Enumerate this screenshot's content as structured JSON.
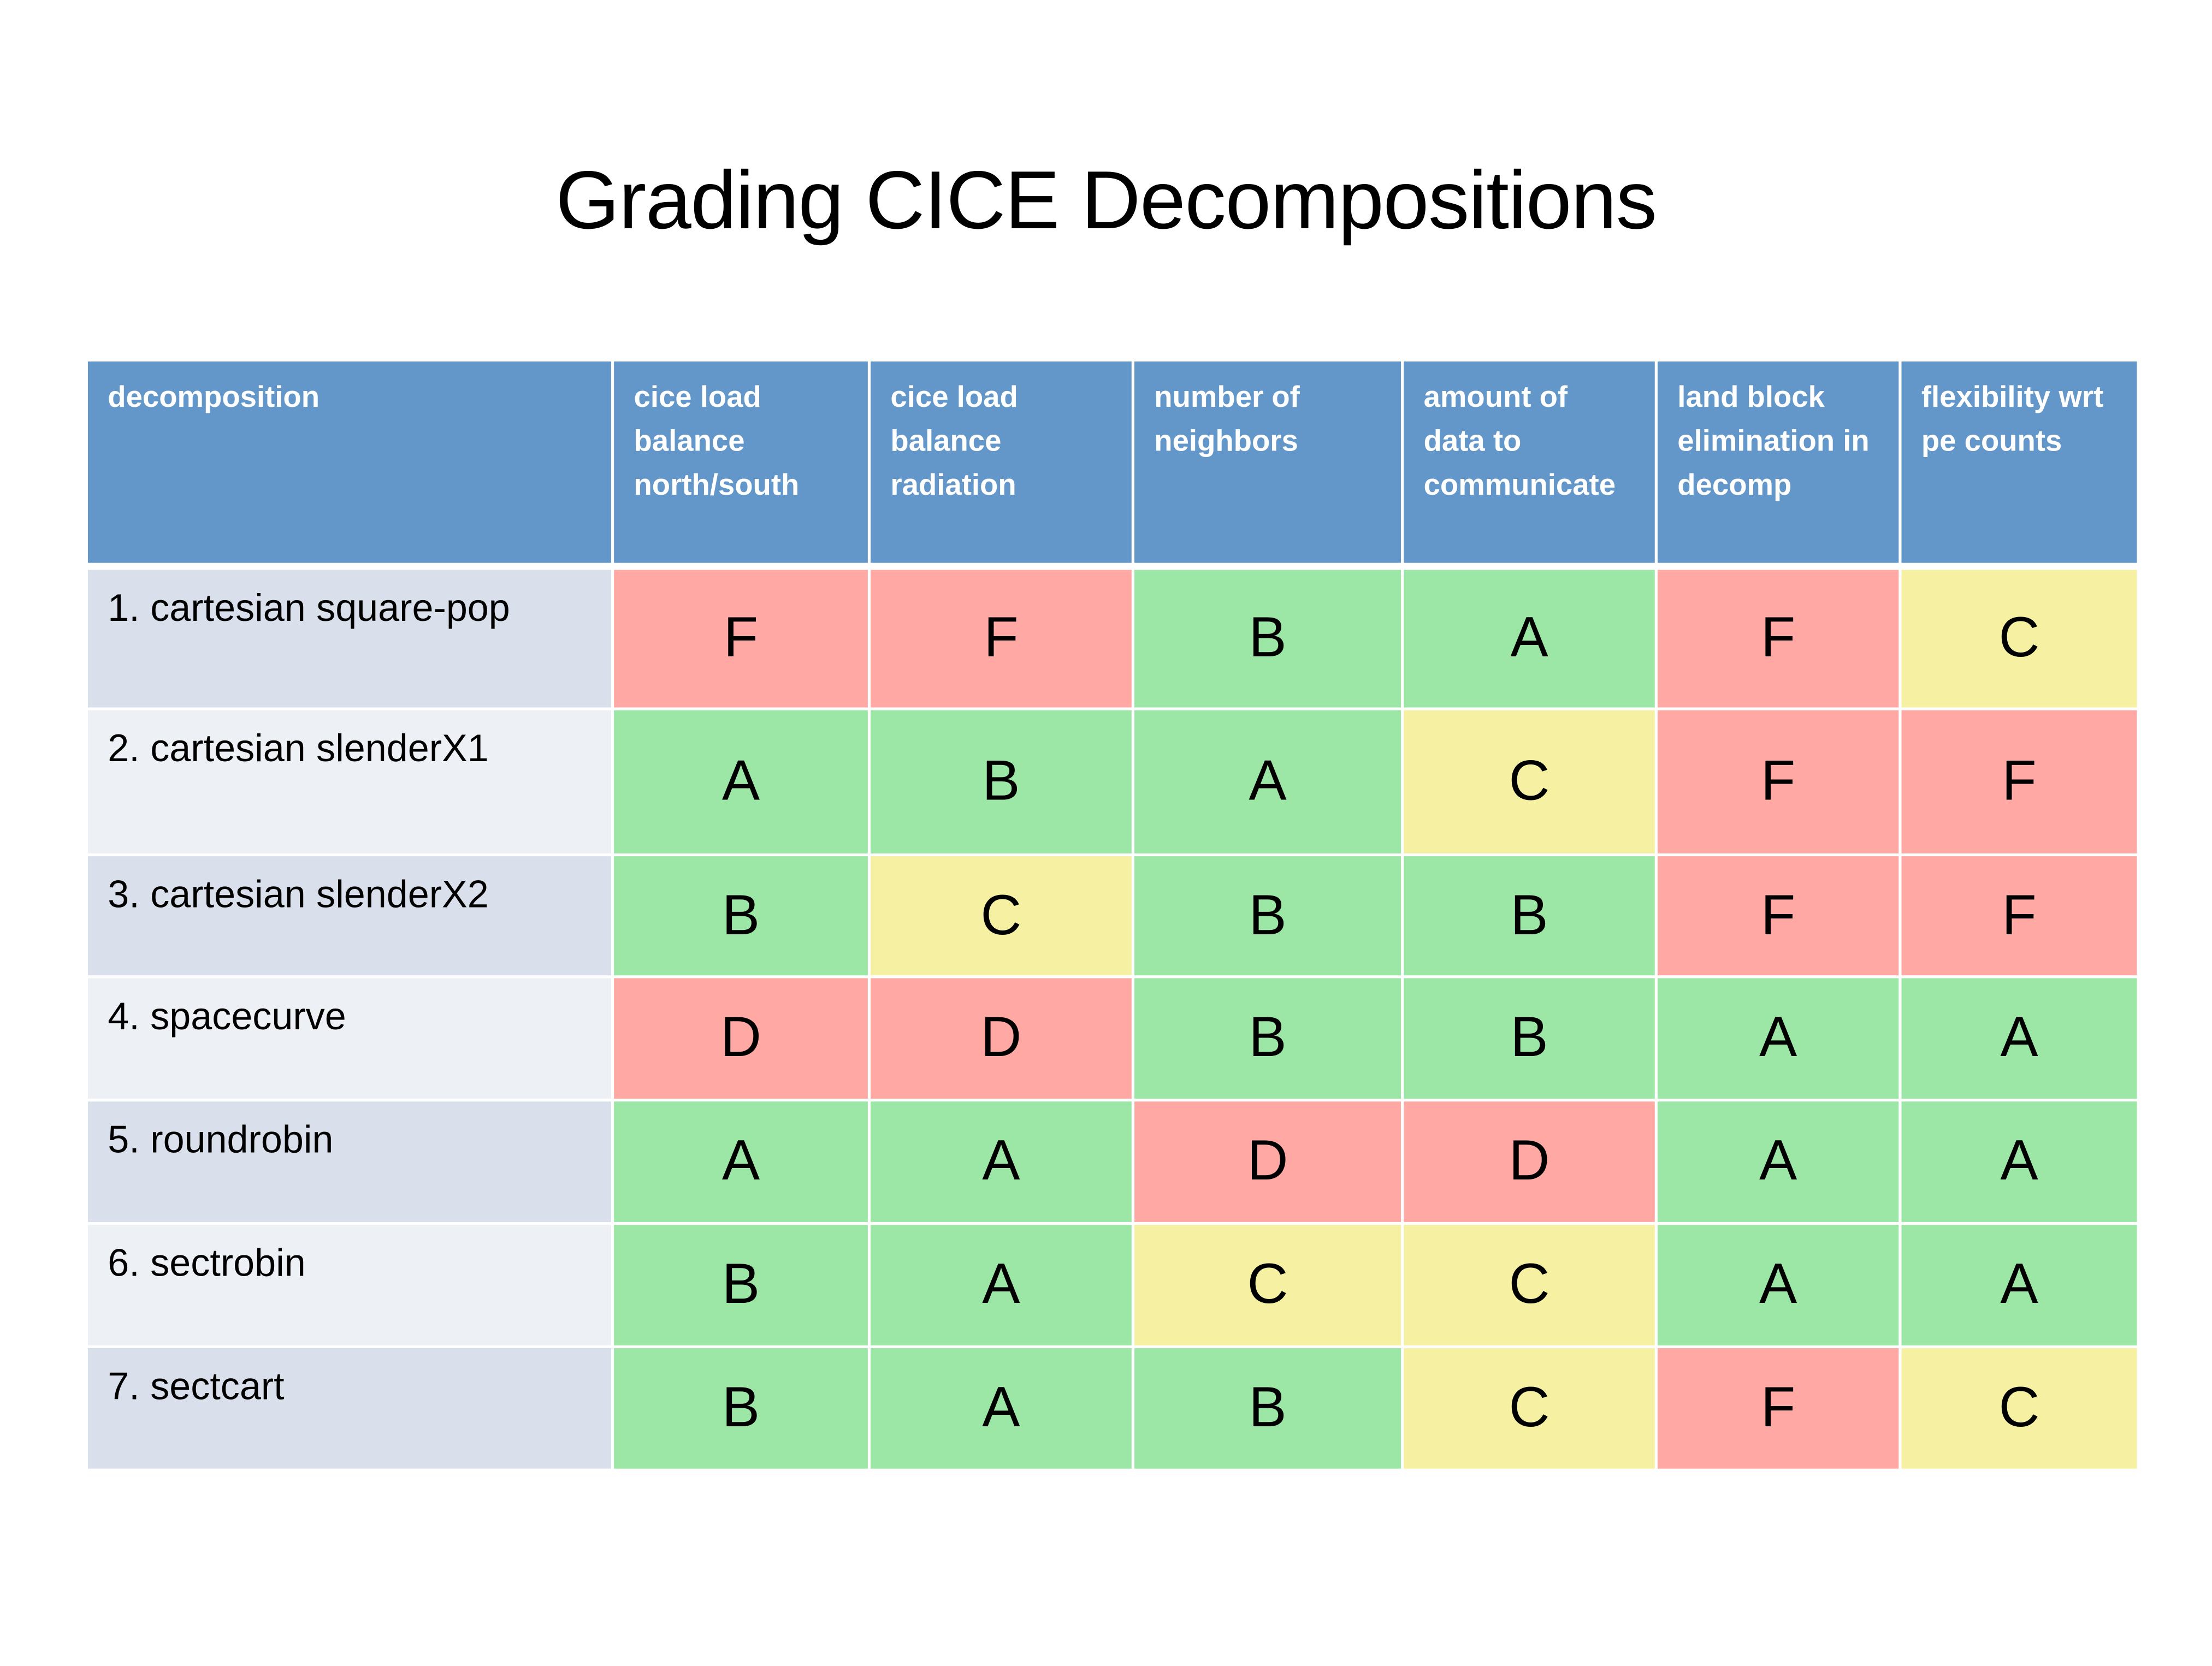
{
  "title": "Grading CICE Decompositions",
  "columns": [
    "decomposition",
    "cice load balance north/south",
    "cice load balance radiation",
    "number of neighbors",
    "amount of data to communicate",
    "land block elimination in decomp",
    "flexibility wrt pe counts"
  ],
  "rows": [
    {
      "name": "1. cartesian square-pop",
      "grades": [
        "F",
        "F",
        "B",
        "A",
        "F",
        "C"
      ]
    },
    {
      "name": "2. cartesian slenderX1",
      "grades": [
        "A",
        "B",
        "A",
        "C",
        "F",
        "F"
      ]
    },
    {
      "name": "3. cartesian slenderX2",
      "grades": [
        "B",
        "C",
        "B",
        "B",
        "F",
        "F"
      ]
    },
    {
      "name": "4. spacecurve",
      "grades": [
        "D",
        "D",
        "B",
        "B",
        "A",
        "A"
      ]
    },
    {
      "name": "5. roundrobin",
      "grades": [
        "A",
        "A",
        "D",
        "D",
        "A",
        "A"
      ]
    },
    {
      "name": "6. sectrobin",
      "grades": [
        "B",
        "A",
        "C",
        "C",
        "A",
        "A"
      ]
    },
    {
      "name": "7. sectcart",
      "grades": [
        "B",
        "A",
        "B",
        "C",
        "F",
        "C"
      ]
    }
  ],
  "colors": {
    "header": "#6396c9",
    "good": "#9ce6a6",
    "fair": "#f5f0a2",
    "poor": "#ffa8a4"
  }
}
